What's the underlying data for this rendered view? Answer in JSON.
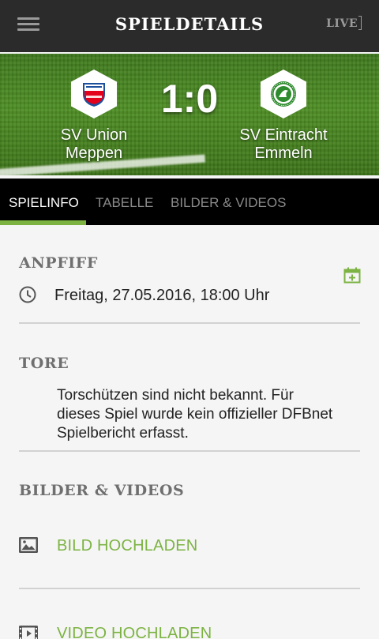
{
  "header": {
    "title": "SPIELDETAILS",
    "live_label": "LIVE"
  },
  "match": {
    "home_team_line1": "SV Union",
    "home_team_line2": "Meppen",
    "away_team_line1": "SV Eintracht",
    "away_team_line2": "Emmeln",
    "score": "1:0"
  },
  "tabs": [
    {
      "label": "SPIELINFO",
      "active": true
    },
    {
      "label": "TABELLE",
      "active": false
    },
    {
      "label": "BILDER & VIDEOS",
      "active": false
    }
  ],
  "anpfiff": {
    "title": "ANPFIFF",
    "datetime": "Freitag, 27.05.2016, 18:00 Uhr"
  },
  "tore": {
    "title": "TORE",
    "line1": "Torschützen sind nicht bekannt. Für",
    "line2": "dieses Spiel wurde kein offizieller DFBnet",
    "line3": "Spielbericht erfasst."
  },
  "media": {
    "title": "BILDER & VIDEOS",
    "upload_image": "BILD HOCHLADEN",
    "upload_video": "VIDEO HOCHLADEN"
  },
  "colors": {
    "accent": "#7cb342",
    "appbar": "#2b2b2b",
    "tabbar": "#000000",
    "home_crest_red": "#e2001a",
    "home_crest_blue": "#1d4f9c",
    "away_crest_green": "#2e8b2e"
  },
  "icons": {
    "menu": "hamburger-menu-icon",
    "calendar_add": "calendar-add-icon",
    "clock": "clock-icon",
    "image": "image-icon",
    "video": "video-icon"
  }
}
